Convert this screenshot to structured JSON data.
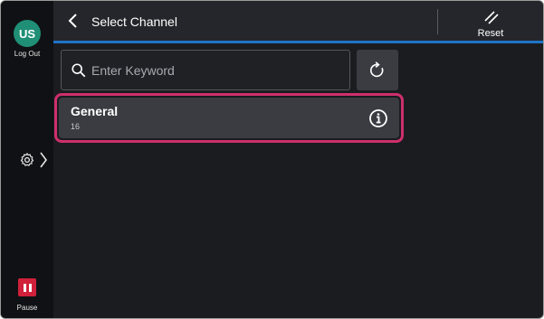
{
  "sidebar": {
    "avatar_initials": "US",
    "logout_label": "Log Out",
    "pause_label": "Pause",
    "pause_color": "#d0203b",
    "avatar_color": "#1f8f76"
  },
  "header": {
    "title": "Select Channel",
    "reset_label": "Reset",
    "accent_color": "#1f74c8"
  },
  "search": {
    "placeholder": "Enter Keyword",
    "value": ""
  },
  "channels": [
    {
      "name": "General",
      "count": "16",
      "selected": true
    }
  ],
  "icons": {
    "back": "chevron-left-icon",
    "reset": "reset-icon",
    "search": "search-icon",
    "refresh": "refresh-icon",
    "info": "info-icon",
    "settings": "gear-icon",
    "expand": "chevron-right-icon",
    "pause": "pause-icon"
  }
}
